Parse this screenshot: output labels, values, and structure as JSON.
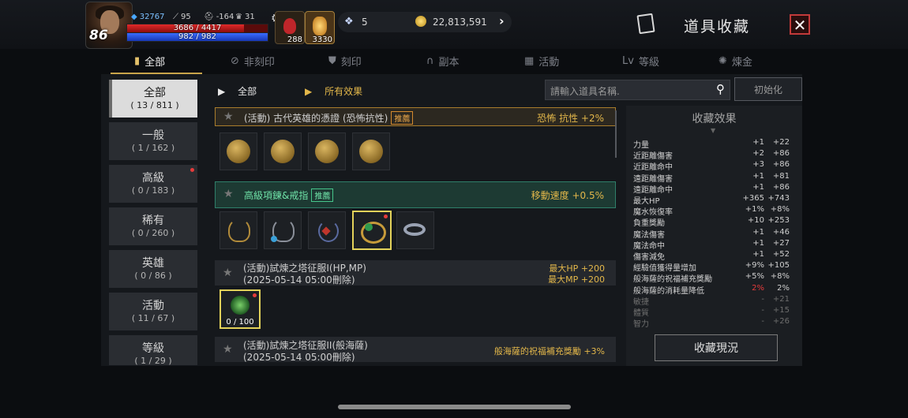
{
  "player": {
    "level": "86",
    "power": "32767",
    "stat1": "95",
    "stat2": "-164",
    "stat3": "31",
    "hp_text": "3686 / 4417",
    "mp_text": "982 / 982",
    "hp_ratio": 0.834,
    "mp_ratio": 1.0
  },
  "quick_slots": [
    {
      "count": "288"
    },
    {
      "count": "3330"
    }
  ],
  "currency": {
    "gem": "5",
    "gold": "22,813,591"
  },
  "header": {
    "title": "道具收藏",
    "close_symbol": "✕"
  },
  "tabs": [
    {
      "label": "全部",
      "icon": "book-icon"
    },
    {
      "label": "非刻印",
      "icon": "no-engrave-icon"
    },
    {
      "label": "刻印",
      "icon": "engrave-icon"
    },
    {
      "label": "副本",
      "icon": "dungeon-icon"
    },
    {
      "label": "活動",
      "icon": "gift-icon"
    },
    {
      "label": "等級",
      "icon": "level-icon"
    },
    {
      "label": "煉金",
      "icon": "alchemy-icon"
    }
  ],
  "categories": [
    {
      "name": "全部",
      "count": "( 13 / 811 )"
    },
    {
      "name": "一般",
      "count": "( 1 / 162 )"
    },
    {
      "name": "高級",
      "count": "( 0 / 183 )"
    },
    {
      "name": "稀有",
      "count": "( 0 / 260 )"
    },
    {
      "name": "英雄",
      "count": "( 0 / 86 )"
    },
    {
      "name": "活動",
      "count": "( 11 / 67 )"
    },
    {
      "name": "等級",
      "count": "( 1 / 29 )"
    }
  ],
  "filters": {
    "type": "全部",
    "effect": "所有效果"
  },
  "search": {
    "placeholder": "請輸入道具名稱.",
    "reset_label": "初始化"
  },
  "collections": [
    {
      "title": "(活動) 古代英雄的憑證 (恐怖抗性)",
      "tag": "推薦",
      "effect": "恐怖 抗性 +2%"
    },
    {
      "title": "高級項鍊&戒指",
      "tag": "推薦",
      "effect": "移動速度 +0.5%"
    },
    {
      "title": "(活動)試煉之塔征服I(HP,MP)",
      "subtitle": "(2025-05-14 05:00刪除)",
      "effect1": "最大HP +200",
      "effect2": "最大MP +200",
      "item_count": "0 / 100"
    },
    {
      "title": "(活動)試煉之塔征服II(般海薩)",
      "subtitle": "(2025-05-14 05:00刪除)",
      "effect": "般海薩的祝福補充獎勵 +3%"
    }
  ],
  "effects_panel": {
    "title": "收藏效果",
    "button_label": "收藏現況",
    "rows": [
      {
        "name": "力量",
        "a": "+1",
        "b": "+22"
      },
      {
        "name": "近距離傷害",
        "a": "+2",
        "b": "+86"
      },
      {
        "name": "近距離命中",
        "a": "+3",
        "b": "+86"
      },
      {
        "name": "遠距離傷害",
        "a": "+1",
        "b": "+81"
      },
      {
        "name": "遠距離命中",
        "a": "+1",
        "b": "+86"
      },
      {
        "name": "最大HP",
        "a": "+365",
        "b": "+743"
      },
      {
        "name": "魔水恢復率",
        "a": "+1%",
        "b": "+8%"
      },
      {
        "name": "負重獎勵",
        "a": "+10",
        "b": "+253"
      },
      {
        "name": "魔法傷害",
        "a": "+1",
        "b": "+46"
      },
      {
        "name": "魔法命中",
        "a": "+1",
        "b": "+27"
      },
      {
        "name": "傷害減免",
        "a": "+1",
        "b": "+52"
      },
      {
        "name": "經驗值獲得量增加",
        "a": "+9%",
        "b": "+105"
      },
      {
        "name": "般海薩的祝福補充獎勵",
        "a": "+5%",
        "b": "+8%"
      },
      {
        "name": "般海薩的消耗量降低",
        "a": "2%",
        "b": "2%"
      },
      {
        "name": "敏捷",
        "a": "-",
        "b": "+21"
      },
      {
        "name": "體質",
        "a": "-",
        "b": "+15"
      },
      {
        "name": "智力",
        "a": "-",
        "b": "+26"
      }
    ]
  },
  "colors": {
    "gold": "#e3b74a",
    "highlight_green": "#46c58a",
    "red": "#e53b3b"
  }
}
